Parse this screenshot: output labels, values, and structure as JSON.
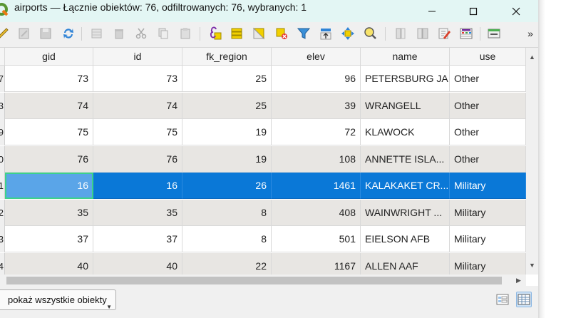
{
  "window": {
    "title": "airports — Łącznie obiektów: 76, odfiltrowanych: 76, wybranych: 1",
    "minimize_icon": "minimize-icon",
    "maximize_icon": "maximize-icon",
    "close_icon": "close-icon"
  },
  "toolbar": {
    "buttons": [
      "edit-pencil-icon",
      "multi-edit-icon",
      "save-edits-icon",
      "reload-icon",
      "add-feature-icon",
      "delete-feature-icon",
      "cut-icon",
      "copy-icon",
      "paste-icon",
      "expression-select-icon",
      "select-all-icon",
      "invert-selection-icon",
      "deselect-icon",
      "filter-icon",
      "move-selection-top-icon",
      "pan-to-selected-icon",
      "zoom-to-selected-icon",
      "new-field-icon",
      "delete-field-icon",
      "field-calculator-icon",
      "conditional-format-icon",
      "dock-icon"
    ],
    "overflow_label": "»"
  },
  "table": {
    "columns": [
      "gid",
      "id",
      "fk_region",
      "elev",
      "name",
      "use"
    ],
    "row_headers": [
      "7",
      "3",
      "9",
      "0",
      "1",
      "2",
      "3",
      "4"
    ],
    "rows": [
      {
        "gid": "73",
        "id": "73",
        "fk_region": "25",
        "elev": "96",
        "name": "PETERSBURG JA...",
        "use": "Other"
      },
      {
        "gid": "74",
        "id": "74",
        "fk_region": "25",
        "elev": "39",
        "name": "WRANGELL",
        "use": "Other"
      },
      {
        "gid": "75",
        "id": "75",
        "fk_region": "19",
        "elev": "72",
        "name": "KLAWOCK",
        "use": "Other"
      },
      {
        "gid": "76",
        "id": "76",
        "fk_region": "19",
        "elev": "108",
        "name": "ANNETTE ISLA...",
        "use": "Other"
      },
      {
        "gid": "16",
        "id": "16",
        "fk_region": "26",
        "elev": "1461",
        "name": "KALAKAKET CR...",
        "use": "Military"
      },
      {
        "gid": "35",
        "id": "35",
        "fk_region": "8",
        "elev": "408",
        "name": "WAINWRIGHT ...",
        "use": "Military"
      },
      {
        "gid": "37",
        "id": "37",
        "fk_region": "8",
        "elev": "501",
        "name": "EIELSON AFB",
        "use": "Military"
      },
      {
        "gid": "40",
        "id": "40",
        "fk_region": "22",
        "elev": "1167",
        "name": "ALLEN AAF",
        "use": "Military"
      }
    ],
    "selected_row_index": 4
  },
  "statusbar": {
    "filter_label": "pokaż wszystkie obiekty",
    "table_view_icon": "table-view-icon",
    "form_view_icon": "form-view-icon"
  },
  "colors": {
    "titlebar": "#e3f6f4",
    "selection": "#0a78d7",
    "current_cell_outline": "#3dd28a",
    "alt_row": "#e8e6e3"
  }
}
